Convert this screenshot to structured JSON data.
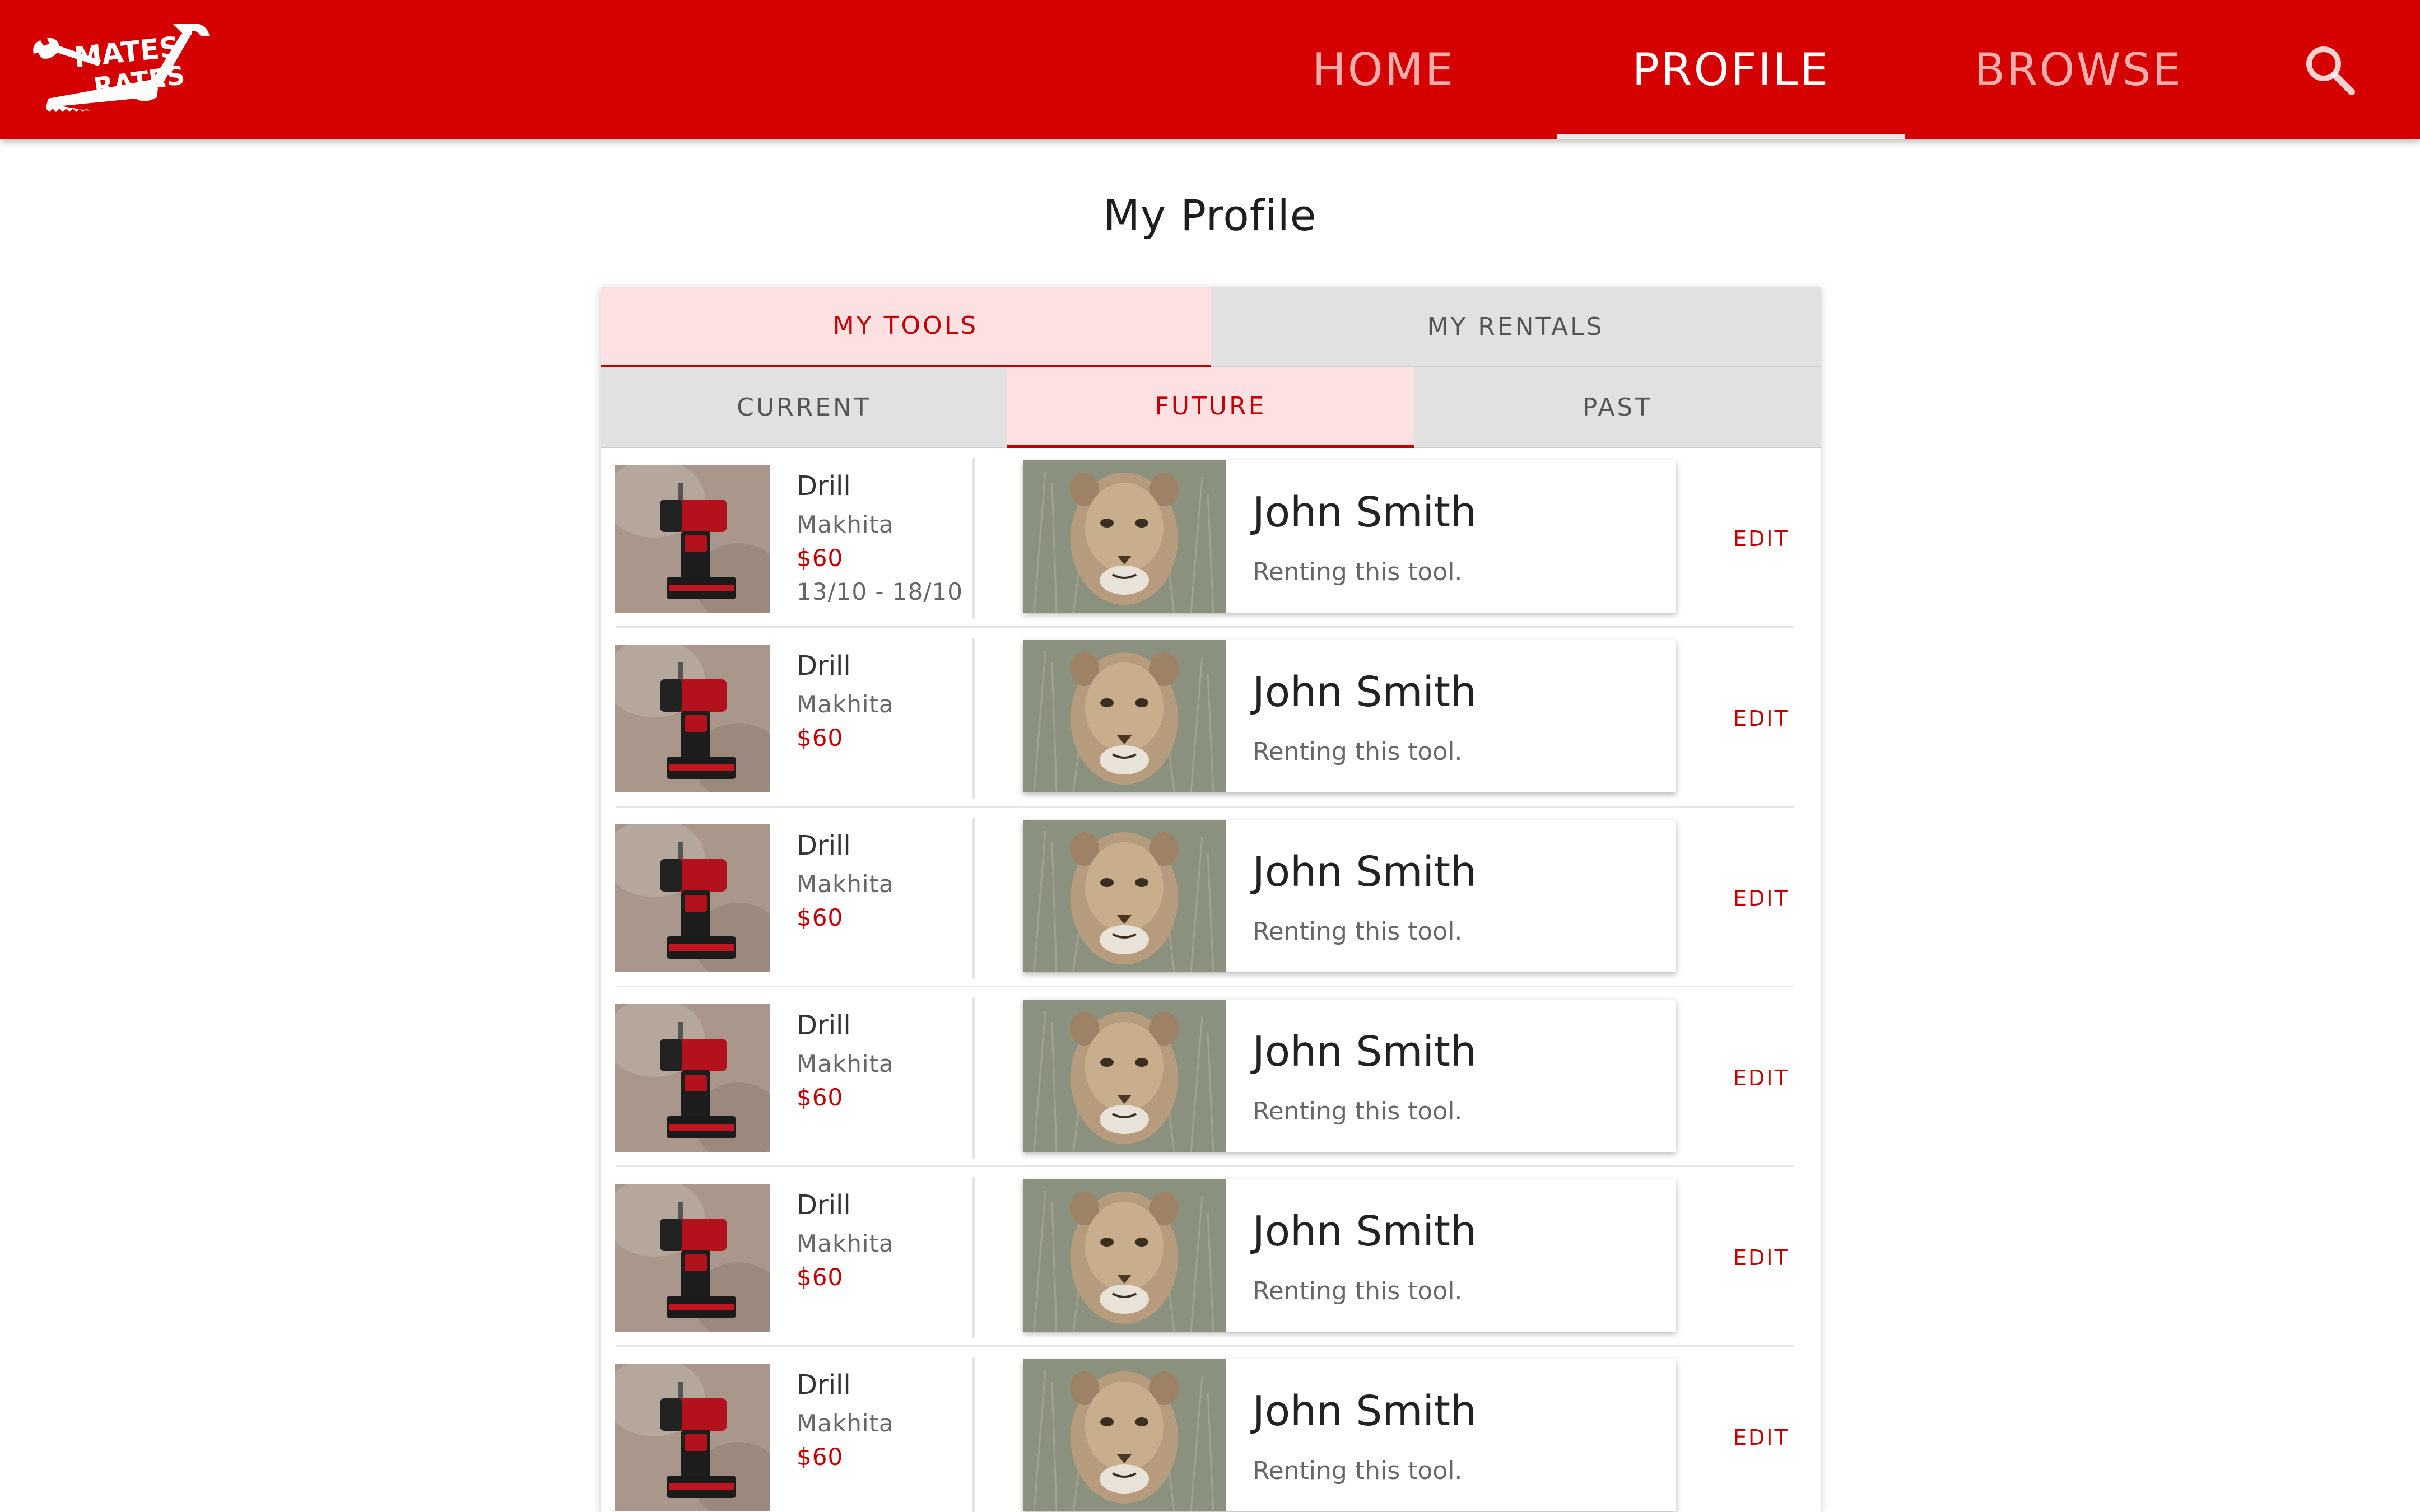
{
  "app": {
    "logo_text": "Mates Rates",
    "brand_color": "#d50000",
    "accent_color": "#c40000",
    "active_tab_bg": "#fde0e2",
    "tab_bg": "#e1e1e1"
  },
  "nav": {
    "tabs": [
      {
        "label": "HOME",
        "active": false
      },
      {
        "label": "PROFILE",
        "active": true
      },
      {
        "label": "BROWSE",
        "active": false
      }
    ],
    "search_icon": "search-icon"
  },
  "page": {
    "title": "My Profile"
  },
  "profile_tabs": [
    {
      "label": "MY TOOLS",
      "active": true
    },
    {
      "label": "MY RENTALS",
      "active": false
    }
  ],
  "period_tabs": [
    {
      "label": "CURRENT",
      "active": false
    },
    {
      "label": "FUTURE",
      "active": true
    },
    {
      "label": "PAST",
      "active": false
    }
  ],
  "rentals": [
    {
      "tool": "Drill",
      "brand": "Makhita",
      "price": "$60",
      "dates": "13/10 - 18/10",
      "renter": "John Smith",
      "status": "Renting this tool.",
      "action": "EDIT"
    },
    {
      "tool": "Drill",
      "brand": "Makhita",
      "price": "$60",
      "dates": "",
      "renter": "John Smith",
      "status": "Renting this tool.",
      "action": "EDIT"
    },
    {
      "tool": "Drill",
      "brand": "Makhita",
      "price": "$60",
      "dates": "",
      "renter": "John Smith",
      "status": "Renting this tool.",
      "action": "EDIT"
    },
    {
      "tool": "Drill",
      "brand": "Makhita",
      "price": "$60",
      "dates": "",
      "renter": "John Smith",
      "status": "Renting this tool.",
      "action": "EDIT"
    },
    {
      "tool": "Drill",
      "brand": "Makhita",
      "price": "$60",
      "dates": "",
      "renter": "John Smith",
      "status": "Renting this tool.",
      "action": "EDIT"
    },
    {
      "tool": "Drill",
      "brand": "Makhita",
      "price": "$60",
      "dates": "",
      "renter": "John Smith",
      "status": "Renting this tool.",
      "action": "EDIT"
    }
  ]
}
